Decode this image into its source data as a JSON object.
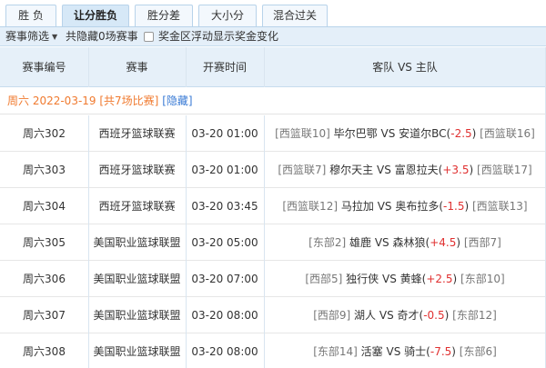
{
  "tabs": [
    {
      "label": "胜 负",
      "active": false
    },
    {
      "label": "让分胜负",
      "active": true
    },
    {
      "label": "胜分差",
      "active": false
    },
    {
      "label": "大小分",
      "active": false
    },
    {
      "label": "混合过关",
      "active": false
    }
  ],
  "filter": {
    "label": "赛事筛选",
    "hidden_text": "共隐藏0场赛事",
    "checkbox_label": "奖金区浮动显示奖金变化"
  },
  "headers": {
    "match_no": "赛事编号",
    "league": "赛事",
    "time": "开赛时间",
    "teams": "客队 VS 主队"
  },
  "date_group": {
    "text": "周六 2022-03-19 [共7场比赛]",
    "hide_label": "[隐藏]"
  },
  "vs_label": "VS",
  "colors": {
    "accent_orange": "#f07a2f",
    "handicap_red": "#e03030",
    "link_blue": "#3a7bd5",
    "header_bg": "#e6f0f9"
  },
  "matches": [
    {
      "no": "周六302",
      "league": "西班牙篮球联赛",
      "time": "03-20 01:00",
      "away_rank": "[西篮联10]",
      "away": "毕尔巴鄂",
      "home": "安道尔BC",
      "handicap": "-2.5",
      "home_rank": "[西篮联16]"
    },
    {
      "no": "周六303",
      "league": "西班牙篮球联赛",
      "time": "03-20 01:00",
      "away_rank": "[西篮联7]",
      "away": "穆尔天主",
      "home": "富恩拉夫",
      "handicap": "+3.5",
      "home_rank": "[西篮联17]"
    },
    {
      "no": "周六304",
      "league": "西班牙篮球联赛",
      "time": "03-20 03:45",
      "away_rank": "[西篮联12]",
      "away": "马拉加",
      "home": "奥布拉多",
      "handicap": "-1.5",
      "home_rank": "[西篮联13]"
    },
    {
      "no": "周六305",
      "league": "美国职业篮球联盟",
      "time": "03-20 05:00",
      "away_rank": "[东部2]",
      "away": "雄鹿",
      "home": "森林狼",
      "handicap": "+4.5",
      "home_rank": "[西部7]"
    },
    {
      "no": "周六306",
      "league": "美国职业篮球联盟",
      "time": "03-20 07:00",
      "away_rank": "[西部5]",
      "away": "独行侠",
      "home": "黄蜂",
      "handicap": "+2.5",
      "home_rank": "[东部10]"
    },
    {
      "no": "周六307",
      "league": "美国职业篮球联盟",
      "time": "03-20 08:00",
      "away_rank": "[西部9]",
      "away": "湖人",
      "home": "奇才",
      "handicap": "-0.5",
      "home_rank": "[东部12]"
    },
    {
      "no": "周六308",
      "league": "美国职业篮球联盟",
      "time": "03-20 08:00",
      "away_rank": "[东部14]",
      "away": "活塞",
      "home": "骑士",
      "handicap": "-7.5",
      "home_rank": "[东部6]"
    }
  ]
}
